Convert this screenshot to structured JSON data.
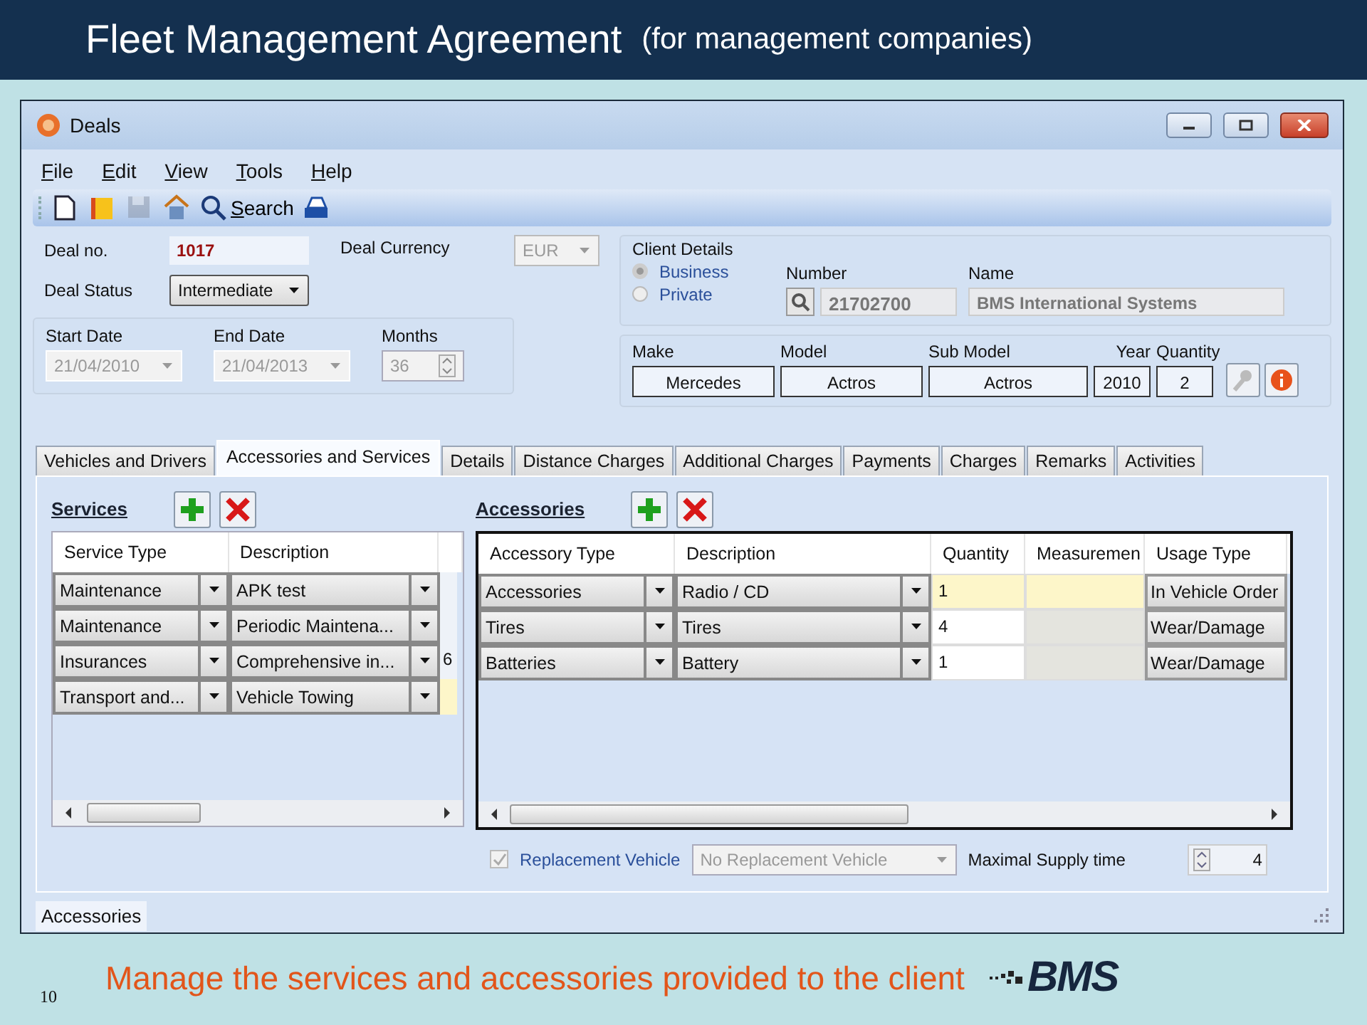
{
  "slide": {
    "title": "Fleet Management Agreement",
    "subtitle": "(for management companies)",
    "caption": "Manage the services and accessories provided to the client",
    "page_number": "10",
    "logo_text": "BMS"
  },
  "window": {
    "title": "Deals"
  },
  "menu": [
    "File",
    "Edit",
    "View",
    "Tools",
    "Help"
  ],
  "toolbar": [
    {
      "kind": "new"
    },
    {
      "kind": "open"
    },
    {
      "kind": "save",
      "disabled": true
    },
    {
      "kind": "report"
    },
    {
      "kind": "search",
      "label": "Search"
    },
    {
      "kind": "print"
    }
  ],
  "deal": {
    "number_label": "Deal no.",
    "number": "1017",
    "currency_label": "Deal Currency",
    "currency": "EUR",
    "status_label": "Deal Status",
    "status": "Intermediate"
  },
  "client": {
    "legend": "Client Details",
    "types": [
      {
        "label": "Business",
        "selected": true
      },
      {
        "label": "Private",
        "selected": false
      }
    ],
    "number_label": "Number",
    "number": "21702700",
    "name_label": "Name",
    "name": "BMS International Systems"
  },
  "dates": {
    "start_label": "Start Date",
    "start": "21/04/2010",
    "end_label": "End Date",
    "end": "21/04/2013",
    "months_label": "Months",
    "months": "36"
  },
  "vehicle": {
    "columns": [
      "Make",
      "Model",
      "Sub Model",
      "Year",
      "Quantity"
    ],
    "values": [
      "Mercedes",
      "Actros",
      "Actros",
      "2010",
      "2"
    ]
  },
  "tabs": [
    {
      "label": "Vehicles and Drivers",
      "selected": false
    },
    {
      "label": "Accessories and Services",
      "selected": true
    },
    {
      "label": "Details",
      "selected": false
    },
    {
      "label": "Distance Charges",
      "selected": false
    },
    {
      "label": "Additional Charges",
      "selected": false
    },
    {
      "label": "Payments",
      "selected": false
    },
    {
      "label": "Charges",
      "selected": false
    },
    {
      "label": "Remarks",
      "selected": false
    },
    {
      "label": "Activities",
      "selected": false
    }
  ],
  "services": {
    "title": "Services",
    "columns": [
      "Service Type",
      "Description"
    ],
    "rows": [
      {
        "service_type": "Maintenance",
        "description": "APK test",
        "selected": false
      },
      {
        "service_type": "Maintenance",
        "description": "Periodic Maintena...",
        "selected": false
      },
      {
        "service_type": "Insurances",
        "description": "Comprehensive in...",
        "column_3": "6",
        "selected": false
      },
      {
        "service_type": "Transport and...",
        "description": "Vehicle Towing",
        "selected": true
      }
    ]
  },
  "accessories": {
    "title": "Accessories",
    "columns": [
      "Accessory Type",
      "Description",
      "Quantity",
      "Measuremen",
      "Usage Type"
    ],
    "rows": [
      {
        "accessory_type": "Accessories",
        "description": "Radio / CD",
        "quantity": "1",
        "usage_type": "In Vehicle Order",
        "selected": true
      },
      {
        "accessory_type": "Tires",
        "description": "Tires",
        "quantity": "4",
        "usage_type": "Wear/Damage",
        "selected": false
      },
      {
        "accessory_type": "Batteries",
        "description": "Battery",
        "quantity": "1",
        "usage_type": "Wear/Damage",
        "selected": false
      }
    ]
  },
  "replacement": {
    "checked": true,
    "label": "Replacement Vehicle",
    "vehicle": "No Replacement Vehicle",
    "supply_label": "Maximal Supply time",
    "supply": "4"
  },
  "status_bar": {
    "text": "Accessories"
  }
}
